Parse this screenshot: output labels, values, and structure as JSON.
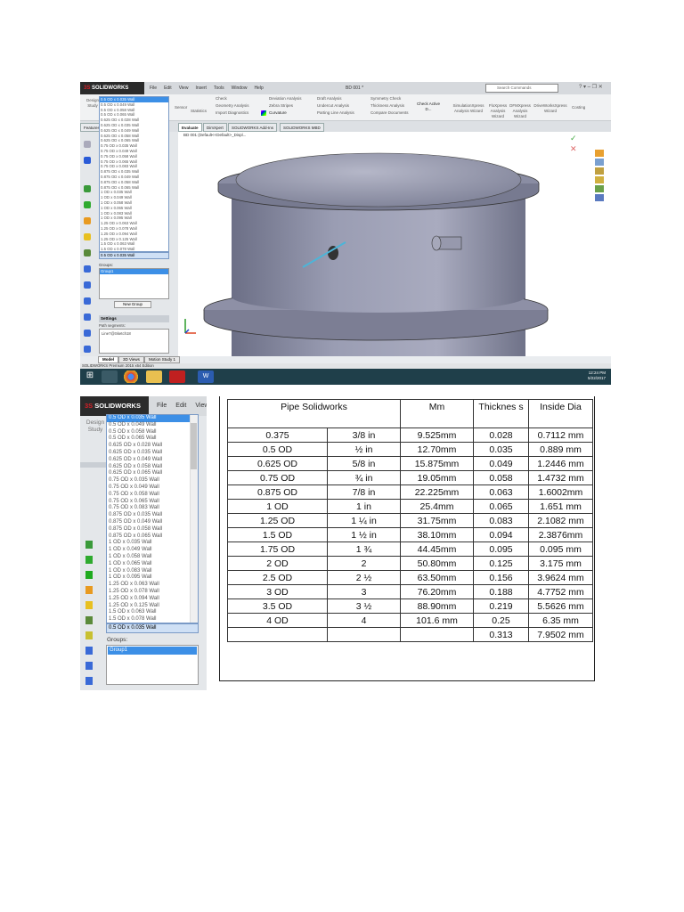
{
  "screenshot1": {
    "app": {
      "logo": "SOLIDWORKS",
      "menu": [
        "File",
        "Edit",
        "View",
        "Insert",
        "Tools",
        "Window",
        "Help"
      ],
      "document_title": "BD 001 *",
      "search_placeholder": "Search Commands"
    },
    "ribbon": {
      "design_study": "Design Study",
      "sensor": "Sensor",
      "statistics": "Statistics",
      "check": "Check",
      "geometry_analysis": "Geometry Analysis",
      "import_diagnostics": "Import Diagnostics",
      "deviation_analysis": "Deviation Analysis",
      "zebra_stripes": "Zebra Stripes",
      "curvature": "Curvature",
      "draft_analysis": "Draft Analysis",
      "undercut_analysis": "Undercut Analysis",
      "parting_line_analysis": "Parting Line Analysis",
      "symmetry_check": "Symmetry Check",
      "thickness_analysis": "Thickness Analysis",
      "compare_documents": "Compare Documents",
      "check_active": "Check Active D...",
      "simulation_xpress": "SimulationXpress Analysis Wizard",
      "floxpress": "FloXpress Analysis Wizard",
      "dfmxpress": "DFMXpress Analysis Wizard",
      "driveworks": "DriveWorksXpress Wizard",
      "costing": "Costing"
    },
    "tabs": [
      "Features",
      "Evaluate",
      "DimXpert",
      "SOLIDWORKS Add-Ins",
      "SOLIDWORKS MBD"
    ],
    "tree_root": "BD 001 (Default<<Default>_Displ...",
    "groups_label": "Groups:",
    "group_selected": "Group1",
    "new_group_button": "New Group",
    "settings_header": "Settings",
    "path_segments_label": "Path segments:",
    "path_segment_value": "Line7@Sketch18",
    "bottom_tabs": [
      "Model",
      "3D Views",
      "Motion Study 1"
    ],
    "status_text": "SOLIDWORKS Premium 2015 x64 Edition",
    "clock_time": "12:24 PM",
    "clock_date": "5/22/2017"
  },
  "screenshot2": {
    "logo": "SOLIDWORKS",
    "menu": [
      "File",
      "Edit",
      "View"
    ],
    "design_study": "Design Study",
    "groups_label": "Groups:",
    "group_selected": "Group1"
  },
  "pipe_sizes": [
    "0.5 OD x 0.035 Wall",
    "0.5 OD x 0.049 Wall",
    "0.5 OD x 0.058 Wall",
    "0.5 OD x 0.065 Wall",
    "0.625 OD x 0.028 Wall",
    "0.625 OD x 0.035 Wall",
    "0.625 OD x 0.049 Wall",
    "0.625 OD x 0.058 Wall",
    "0.625 OD x 0.065 Wall",
    "0.75 OD x 0.035 Wall",
    "0.75 OD x 0.049 Wall",
    "0.75 OD x 0.058 Wall",
    "0.75 OD x 0.065 Wall",
    "0.75 OD x 0.083 Wall",
    "0.875 OD x 0.035 Wall",
    "0.875 OD x 0.049 Wall",
    "0.875 OD x 0.058 Wall",
    "0.875 OD x 0.065 Wall",
    "1 OD x 0.035 Wall",
    "1 OD x 0.049 Wall",
    "1 OD x 0.058 Wall",
    "1 OD x 0.065 Wall",
    "1 OD x 0.083 Wall",
    "1 OD x 0.095 Wall",
    "1.25 OD x 0.063 Wall",
    "1.25 OD x 0.078 Wall",
    "1.25 OD x 0.094 Wall",
    "1.25 OD x 0.125 Wall",
    "1.5 OD x 0.063 Wall",
    "1.5 OD x 0.078 Wall"
  ],
  "selected_pipe_size": "0.5 OD x 0.035 Wall",
  "table": {
    "headers": [
      "Pipe Solidworks",
      "Mm",
      "Thicknes s",
      "Inside Dia"
    ],
    "rows": [
      [
        "0.375",
        "3/8 in",
        "9.525mm",
        "0.028",
        "0.7112 mm"
      ],
      [
        "0.5 OD",
        "½ in",
        "12.70mm",
        "0.035",
        "0.889 mm"
      ],
      [
        "0.625 OD",
        "5/8 in",
        "15.875mm",
        "0.049",
        "1.2446 mm"
      ],
      [
        "0.75 OD",
        "¾ in",
        "19.05mm",
        "0.058",
        "1.4732 mm"
      ],
      [
        "0.875 OD",
        "7/8 in",
        "22.225mm",
        "0.063",
        "1.6002mm"
      ],
      [
        "1 OD",
        "1 in",
        "25.4mm",
        "0.065",
        "1.651 mm"
      ],
      [
        "1.25 OD",
        "1 ¼  in",
        "31.75mm",
        "0.083",
        "2.1082 mm"
      ],
      [
        "1.5 OD",
        "1 ½ in",
        "38.10mm",
        "0.094",
        "2.3876mm"
      ],
      [
        "1.75 OD",
        "1 ¾",
        "44.45mm",
        "0.095",
        "0.095 mm"
      ],
      [
        "2 OD",
        "2",
        "50.80mm",
        "0.125",
        "3.175 mm"
      ],
      [
        "2.5 OD",
        "2 ½",
        "63.50mm",
        "0.156",
        "3.9624 mm"
      ],
      [
        "3 OD",
        "3",
        "76.20mm",
        "0.188",
        "4.7752 mm"
      ],
      [
        "3.5 OD",
        "3 ½",
        "88.90mm",
        "0.219",
        "5.5626 mm"
      ],
      [
        "4 OD",
        "4",
        "101.6 mm",
        "0.25",
        "6.35 mm"
      ],
      [
        "",
        "",
        "",
        "0.313",
        "7.9502 mm"
      ]
    ]
  }
}
